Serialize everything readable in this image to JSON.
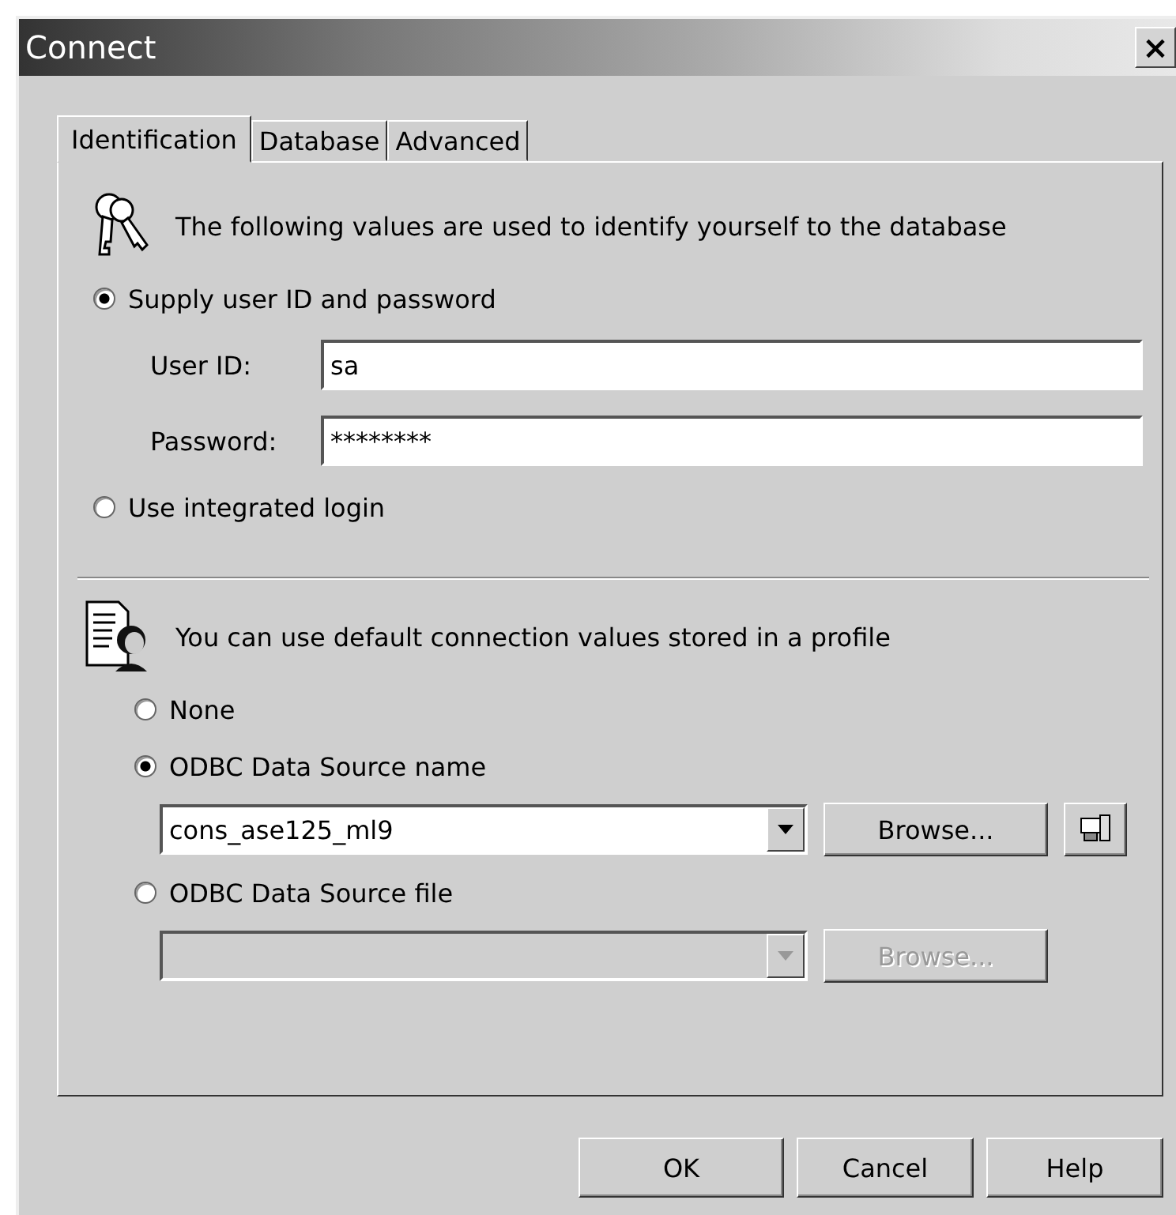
{
  "window": {
    "title": "Connect",
    "close": "×"
  },
  "tabs": [
    {
      "label": "Identification",
      "selected": true
    },
    {
      "label": "Database",
      "selected": false
    },
    {
      "label": "Advanced",
      "selected": false
    }
  ],
  "login": {
    "description": "The following values are used to identify yourself to the database",
    "options": [
      {
        "label": "Supply user ID and password",
        "selected": true,
        "fields": [
          {
            "label": "User ID:",
            "value": "sa"
          },
          {
            "label": "Password:",
            "value": "********"
          }
        ]
      },
      {
        "label": "Use integrated login",
        "selected": false
      }
    ]
  },
  "profile": {
    "description": "You can use default connection values stored in a profile",
    "options": [
      {
        "label": "None",
        "selected": false
      },
      {
        "label": "ODBC Data Source name",
        "selected": true,
        "combo": {
          "value": "cons_ase125_ml9",
          "disabled": false
        },
        "browse": {
          "label": "Browse...",
          "disabled": false
        },
        "icon_button": true
      },
      {
        "label": "ODBC Data Source file",
        "selected": false,
        "combo": {
          "disabled": true
        },
        "browse": {
          "label": "Browse...",
          "disabled": true
        }
      }
    ]
  },
  "buttons": [
    "OK",
    "Cancel",
    "Help"
  ]
}
